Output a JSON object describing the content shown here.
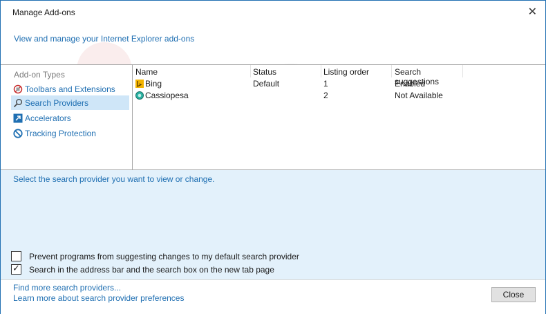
{
  "window": {
    "title": "Manage Add-ons",
    "subtitle": "View and manage your Internet Explorer add-ons"
  },
  "sidebar": {
    "heading": "Add-on Types",
    "items": [
      {
        "label": "Toolbars and Extensions",
        "icon": "toolbars-extensions-icon"
      },
      {
        "label": "Search Providers",
        "icon": "search-icon",
        "selected": true
      },
      {
        "label": "Accelerators",
        "icon": "accelerator-icon"
      },
      {
        "label": "Tracking Protection",
        "icon": "tracking-protection-icon"
      }
    ]
  },
  "list": {
    "columns": [
      "Name",
      "Status",
      "Listing order",
      "Search suggestions"
    ],
    "rows": [
      {
        "name": "Bing",
        "status": "Default",
        "order": "1",
        "suggestions": "Enabled",
        "icon": "bing-icon"
      },
      {
        "name": "Cassiopesa",
        "status": "",
        "order": "2",
        "suggestions": "Not Available",
        "icon": "globe-icon"
      }
    ]
  },
  "details": {
    "hint": "Select the search provider you want to view or change.",
    "checkboxes": [
      {
        "label": "Prevent programs from suggesting changes to my default search provider",
        "checked": false
      },
      {
        "label": "Search in the address bar and the search box on the new tab page",
        "checked": true
      }
    ]
  },
  "footer": {
    "link1": "Find more search providers...",
    "link2": "Learn more about search provider preferences",
    "close_label": "Close"
  },
  "colors": {
    "accent": "#1f6fb2",
    "selection": "#cfe6f8",
    "details_bg": "#e3f1fb"
  }
}
